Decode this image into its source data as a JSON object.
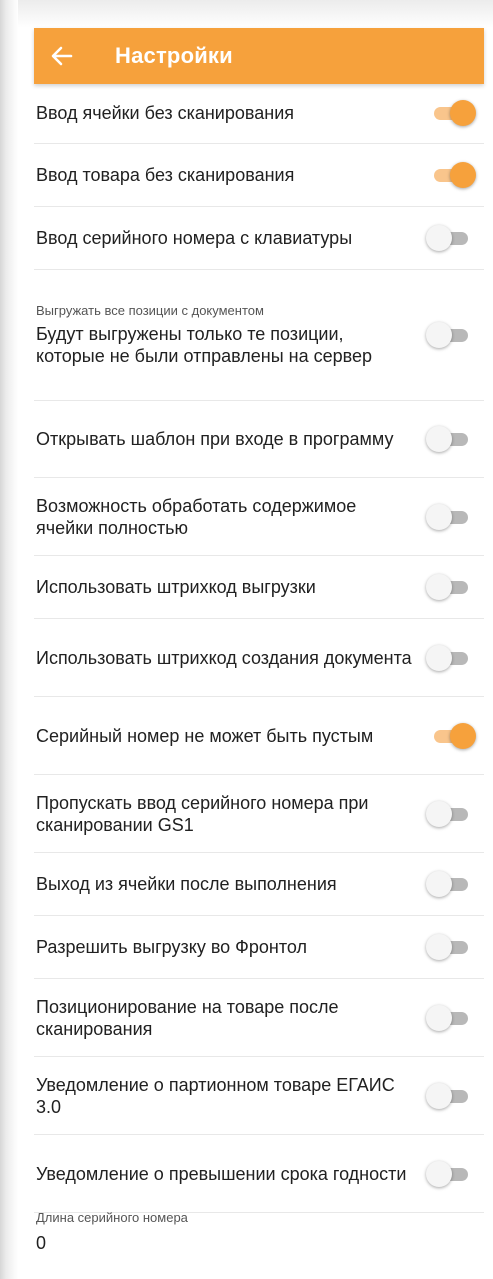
{
  "appbar": {
    "title": "Настройки",
    "back_icon": "arrow-left-icon",
    "color": "#f6a13c"
  },
  "settings": [
    {
      "label": "Ввод ячейки без сканирования",
      "on": true
    },
    {
      "label": "Ввод товара без сканирования",
      "on": true
    },
    {
      "label": "Ввод серийного номера с клавиатуры",
      "on": false
    },
    {
      "sublabel": "Выгружать все позиции с документом",
      "label": "Будут выгружены только те позиции, которые не были отправлены на сервер",
      "on": false
    },
    {
      "label": "Открывать шаблон при входе в программу",
      "on": false
    },
    {
      "label": "Возможность обработать содержимое ячейки полностью",
      "on": false
    },
    {
      "label": "Использовать штрихкод выгрузки",
      "on": false
    },
    {
      "label": "Использовать штрихкод создания документа",
      "on": false
    },
    {
      "label": "Серийный номер не может быть пустым",
      "on": true
    },
    {
      "label": "Пропускать ввод серийного номера при сканировании GS1",
      "on": false
    },
    {
      "label": "Выход из ячейки после выполнения",
      "on": false
    },
    {
      "label": "Разрешить выгрузку во Фронтол",
      "on": false
    },
    {
      "label": "Позиционирование на товаре после сканирования",
      "on": false
    },
    {
      "label": "Уведомление о партионном товаре ЕГАИС 3.0",
      "on": false
    },
    {
      "label": "Уведомление о превышении срока годности",
      "on": false
    }
  ],
  "serial_length": {
    "label": "Длина серийного номера",
    "value": "0"
  }
}
